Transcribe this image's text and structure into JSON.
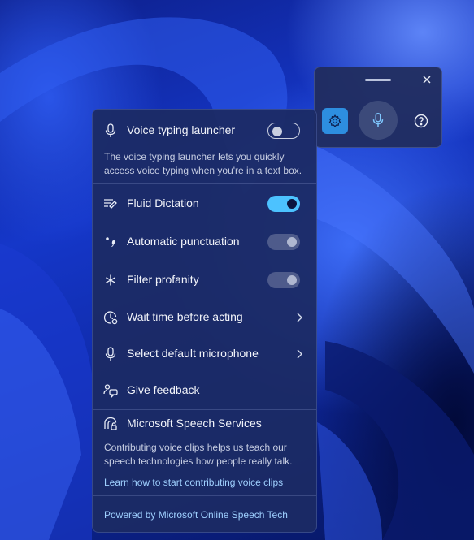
{
  "toolbar": {
    "icons": {
      "handle": "drag-handle",
      "close": "close-icon",
      "settings": "gear-icon",
      "mic": "microphone-icon",
      "help": "help-icon"
    }
  },
  "panel": {
    "launcher": {
      "label": "Voice typing launcher",
      "toggle": "off",
      "description": "The voice typing launcher lets you quickly access voice typing when you're in a text box."
    },
    "items": [
      {
        "label": "Fluid Dictation",
        "icon": "fluid-dictation-icon",
        "toggle": "on"
      },
      {
        "label": "Automatic punctuation",
        "icon": "punctuation-icon",
        "toggle": "disabled-on"
      },
      {
        "label": "Filter profanity",
        "icon": "asterisk-icon",
        "toggle": "disabled-on"
      },
      {
        "label": "Wait time before acting",
        "icon": "clock-icon",
        "chevron": true
      },
      {
        "label": "Select default microphone",
        "icon": "microphone-icon",
        "chevron": true
      },
      {
        "label": "Give feedback",
        "icon": "feedback-icon"
      }
    ],
    "speech_services": {
      "label": "Microsoft Speech Services",
      "description": "Contributing voice clips helps us teach our speech technologies how people really talk.",
      "link": "Learn how to start contributing voice clips"
    },
    "footer_link": "Powered by Microsoft Online Speech Tech"
  },
  "colors": {
    "accent": "#4cc2ff",
    "settings_button": "#2d8ee0",
    "panel": "#1c2a64"
  }
}
